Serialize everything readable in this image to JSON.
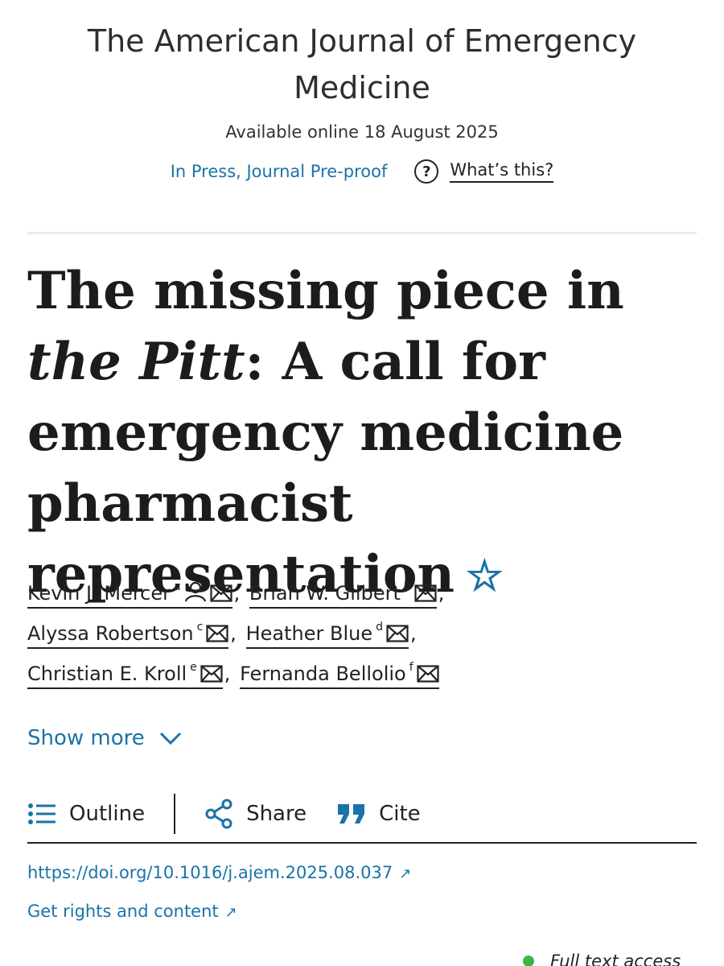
{
  "journal": {
    "title": "The American Journal of Emergency Medicine",
    "available_online": "Available online 18 August 2025",
    "status": "In Press, Journal Pre-proof",
    "whats_this": "What’s this?"
  },
  "article": {
    "title_part1": "The missing piece in ",
    "title_italic": "the Pitt",
    "title_part2": ": A call for emergency medicine pharmacist representation"
  },
  "authors": [
    {
      "name": "Kevin J. Mercer",
      "affiliation": "a",
      "icons": [
        "person-icon",
        "email-icon"
      ]
    },
    {
      "name": "Brian W. Gilbert",
      "affiliation": "b",
      "icons": [
        "email-icon"
      ]
    },
    {
      "name": "Alyssa Robertson",
      "affiliation": "c",
      "icons": [
        "email-icon"
      ]
    },
    {
      "name": "Heather Blue",
      "affiliation": "d",
      "icons": [
        "email-icon"
      ]
    },
    {
      "name": "Christian E. Kroll",
      "affiliation": "e",
      "icons": [
        "email-icon"
      ]
    },
    {
      "name": "Fernanda Bellolio",
      "affiliation": "f",
      "icons": [
        "email-icon"
      ]
    }
  ],
  "show_more": "Show more",
  "toolbar": {
    "outline": "Outline",
    "share": "Share",
    "cite": "Cite"
  },
  "links": {
    "doi": "https://doi.org/10.1016/j.ajem.2025.08.037",
    "rights": "Get rights and content",
    "arrow": "↗"
  },
  "access": "Full text access",
  "colors": {
    "link": "#1a73a8",
    "access_dot": "#3eb34a"
  }
}
